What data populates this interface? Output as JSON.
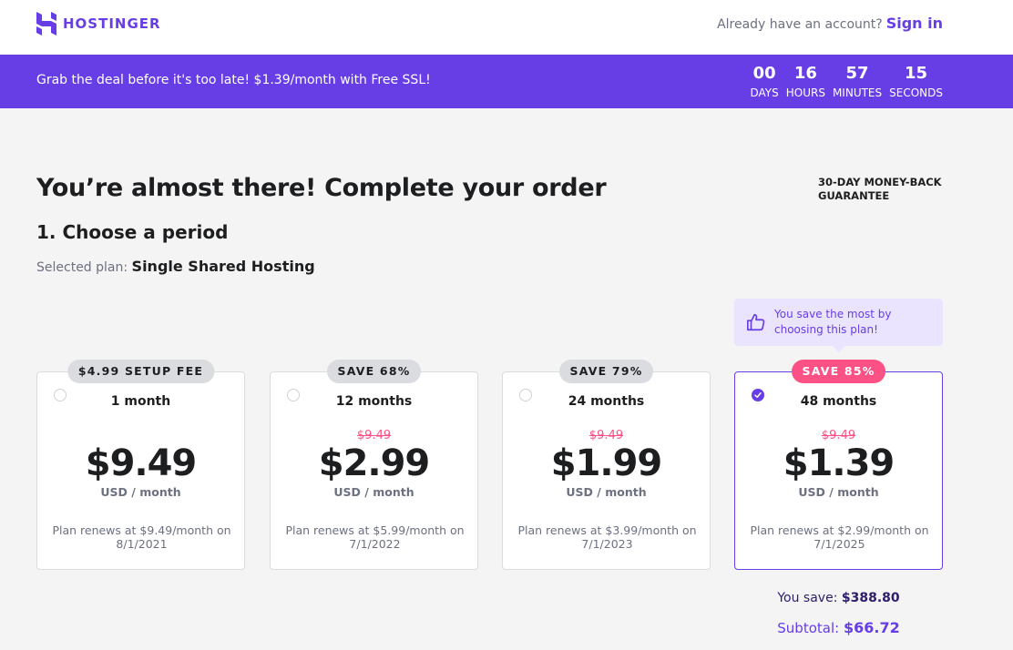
{
  "header": {
    "brand": "HOSTINGER",
    "account_prompt": "Already have an account?",
    "signin_label": "Sign in"
  },
  "promo": {
    "text": "Grab the deal before it's too late! $1.39/month with Free SSL!",
    "countdown": [
      {
        "value": "00",
        "label": "DAYS"
      },
      {
        "value": "16",
        "label": "HOURS"
      },
      {
        "value": "57",
        "label": "MINUTES"
      },
      {
        "value": "15",
        "label": "SECONDS"
      }
    ]
  },
  "main": {
    "title": "You’re almost there! Complete your order",
    "guarantee": "30-DAY MONEY-BACK GUARANTEE",
    "step_title": "1. Choose a period",
    "selected_plan_label": "Selected plan:",
    "selected_plan_value": "Single Shared Hosting",
    "tooltip": "You save the most by choosing this plan!"
  },
  "plans": [
    {
      "badge": "$4.99 SETUP FEE",
      "period": "1 month",
      "old_price": "",
      "price": "$9.49",
      "unit": "USD / month",
      "renew": "Plan renews at $9.49/month on 8/1/2021",
      "selected": false
    },
    {
      "badge": "SAVE 68%",
      "period": "12 months",
      "old_price": "$9.49",
      "price": "$2.99",
      "unit": "USD / month",
      "renew": "Plan renews at $5.99/month on 7/1/2022",
      "selected": false
    },
    {
      "badge": "SAVE 79%",
      "period": "24 months",
      "old_price": "$9.49",
      "price": "$1.99",
      "unit": "USD / month",
      "renew": "Plan renews at $3.99/month on 7/1/2023",
      "selected": false
    },
    {
      "badge": "SAVE 85%",
      "period": "48 months",
      "old_price": "$9.49",
      "price": "$1.39",
      "unit": "USD / month",
      "renew": "Plan renews at $2.99/month on 7/1/2025",
      "selected": true
    }
  ],
  "totals": {
    "save_label": "You save:",
    "save_value": "$388.80",
    "subtotal_label": "Subtotal:",
    "subtotal_value": "$66.72"
  },
  "colors": {
    "accent": "#673de6",
    "highlight": "#fc5185",
    "dark": "#1d1e20"
  }
}
